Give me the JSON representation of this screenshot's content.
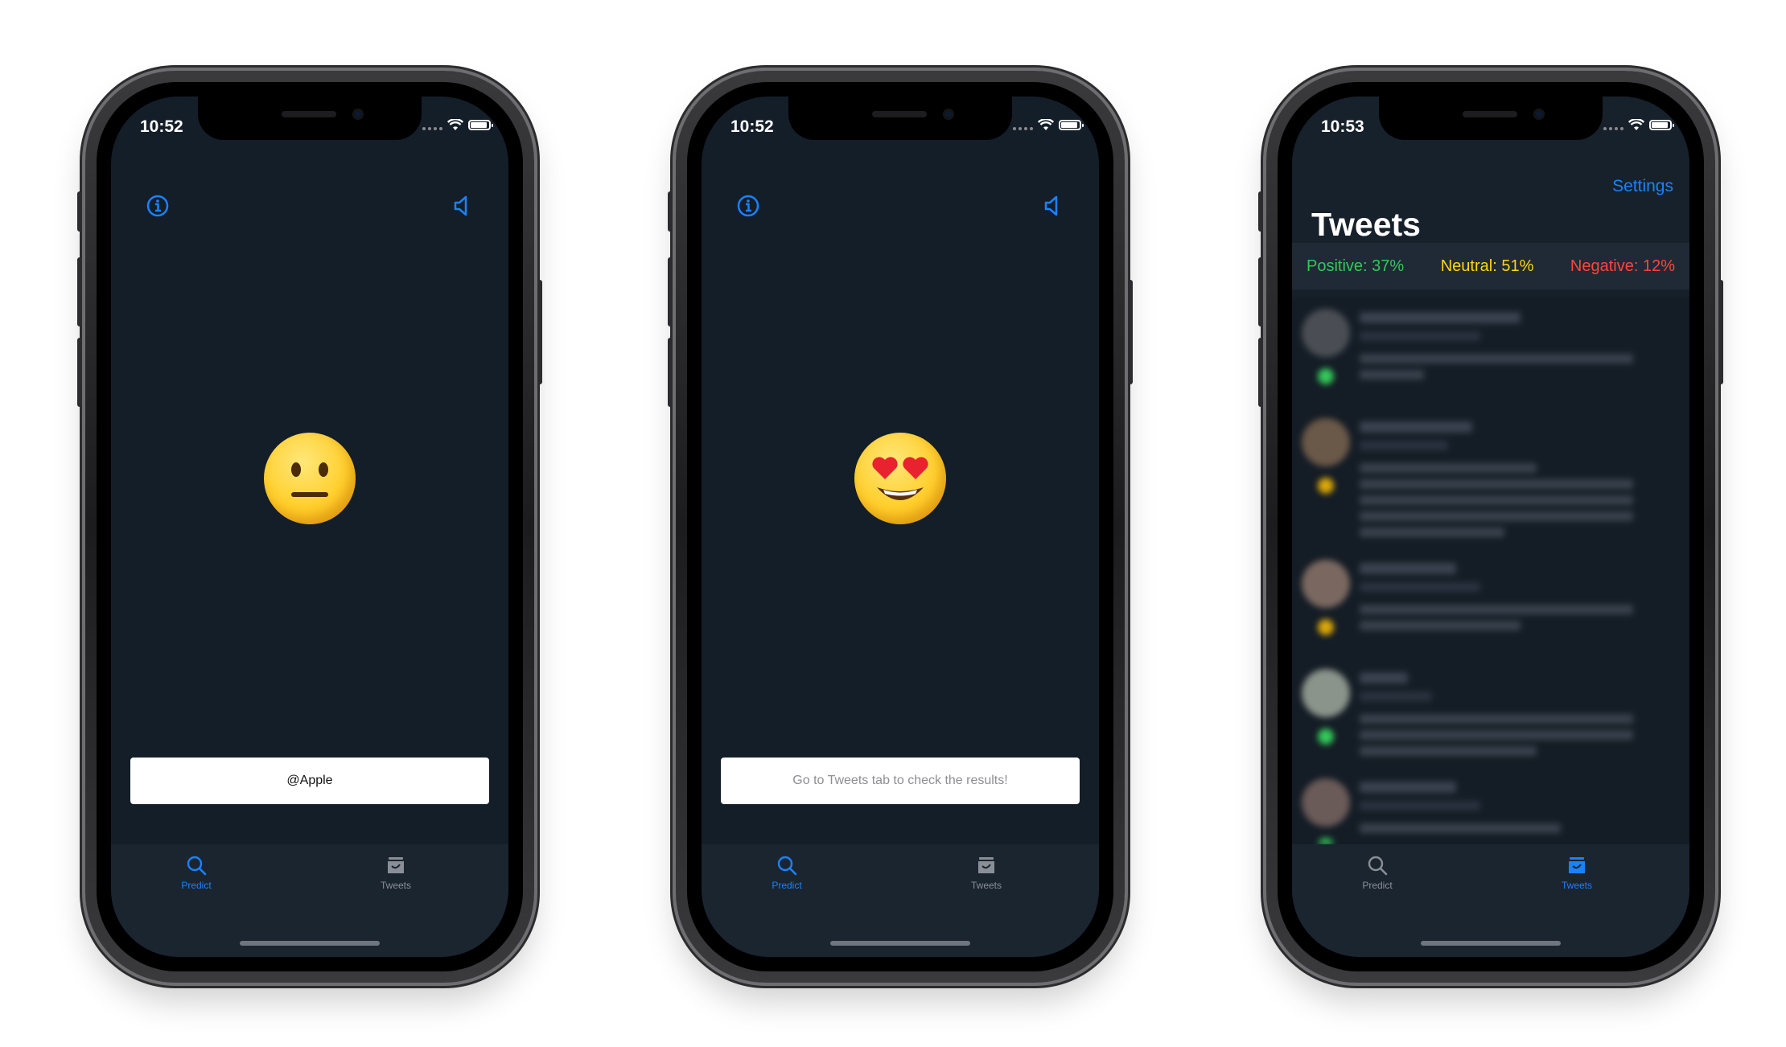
{
  "phones": [
    {
      "time": "10:52",
      "emoji": "neutral",
      "field_text": "@Apple",
      "tabs": [
        {
          "label": "Predict",
          "active": true
        },
        {
          "label": "Tweets",
          "active": false
        }
      ]
    },
    {
      "time": "10:52",
      "emoji": "heart-eyes",
      "field_text": "Go to Tweets tab to check the results!",
      "tabs": [
        {
          "label": "Predict",
          "active": true
        },
        {
          "label": "Tweets",
          "active": false
        }
      ]
    },
    {
      "time": "10:53",
      "settings_label": "Settings",
      "title": "Tweets",
      "stats": {
        "positive": "Positive: 37%",
        "neutral": "Neutral: 51%",
        "negative": "Negative: 12%"
      },
      "tabs": [
        {
          "label": "Predict",
          "active": false
        },
        {
          "label": "Tweets",
          "active": true
        }
      ]
    }
  ],
  "colors": {
    "accent": "#1a82fb",
    "background": "#141e29",
    "positive": "#34c759",
    "neutral": "#ffd60a",
    "negative": "#ff453a"
  }
}
